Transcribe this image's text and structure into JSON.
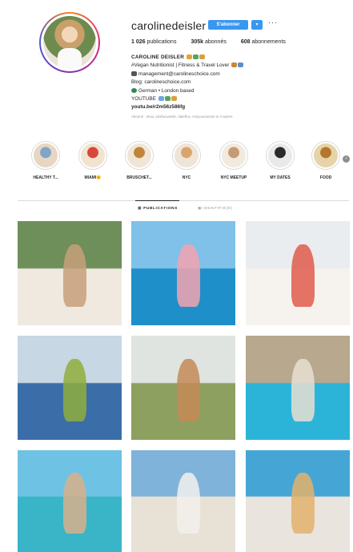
{
  "profile": {
    "username": "carolinedeisler",
    "follow_label": "S'abonner",
    "dropdown_label": "▾",
    "more_label": "···",
    "stats": [
      {
        "num": "1 026",
        "label": "publications"
      },
      {
        "num": "305k",
        "label": "abonnés"
      },
      {
        "num": "608",
        "label": "abonnements"
      }
    ],
    "bio": {
      "name": "CAROLINE DEISLER",
      "lines": [
        "#Vegan Nutritionist | Fitness & Travel Lover",
        "management@carolineschoice.com",
        "Blog: carolineschoice.com",
        "German • London based",
        "YOUTUBE"
      ],
      "link": "youtu.be/r2m56z586fg",
      "followed_by": "Abonné : elsai, arisfaouvielle, dateflux, misyoursunset et 4 autres"
    }
  },
  "highlights": [
    {
      "label": "HEALTHY T...",
      "color_a": "#7fa6c9",
      "color_b": "#e8d6c2"
    },
    {
      "label": "MIAMI🌞",
      "color_a": "#d9463a",
      "color_b": "#f2e2d0"
    },
    {
      "label": "BRUSCHET...",
      "color_a": "#c0843b",
      "color_b": "#f0e5d6"
    },
    {
      "label": "NYC",
      "color_a": "#d9a56e",
      "color_b": "#efe4d8"
    },
    {
      "label": "NYC MEETUP",
      "color_a": "#c69a73",
      "color_b": "#f2e9df"
    },
    {
      "label": "MY DATES",
      "color_a": "#2a2a2a",
      "color_b": "#e9e9e9"
    },
    {
      "label": "FOOD",
      "color_a": "#b5772d",
      "color_b": "#e6d3a8"
    }
  ],
  "tabs": [
    {
      "label": "PUBLICATIONS",
      "icon": "grid-icon"
    },
    {
      "label": "IDENTIFIÉ(E)",
      "icon": "tag-icon"
    }
  ],
  "posts": [
    {
      "alt": "woman sitting among cacti",
      "top": "#6f8f5a",
      "bottom": "#efe9e0",
      "accent": "#c7a07a"
    },
    {
      "alt": "woman on flamingo float in sea",
      "top": "#7fc1e8",
      "bottom": "#1f8fc9",
      "accent": "#f3a3b0"
    },
    {
      "alt": "woman eating watermelon on boat",
      "top": "#e9edf0",
      "bottom": "#f6f3ee",
      "accent": "#e05a4c"
    },
    {
      "alt": "bowl of figs and plums",
      "top": "#c7d7e3",
      "bottom": "#3b6ea8",
      "accent": "#8fae3c"
    },
    {
      "alt": "woman in hat at tropical breakfast",
      "top": "#dfe4e0",
      "bottom": "#8da05f",
      "accent": "#c48a56"
    },
    {
      "alt": "woman floating in pool",
      "top": "#b7a88e",
      "bottom": "#2cb4d8",
      "accent": "#e9dfd2"
    },
    {
      "alt": "woman in turquoise sea",
      "top": "#6ec2e4",
      "bottom": "#3ab5c8",
      "accent": "#d8b08c"
    },
    {
      "alt": "woman walking on beach",
      "top": "#7fb3d9",
      "bottom": "#e8e2d6",
      "accent": "#f2f0ec"
    },
    {
      "alt": "woman with watermelon by sea",
      "top": "#45a6d6",
      "bottom": "#e9e4dd",
      "accent": "#e3b26c"
    }
  ]
}
